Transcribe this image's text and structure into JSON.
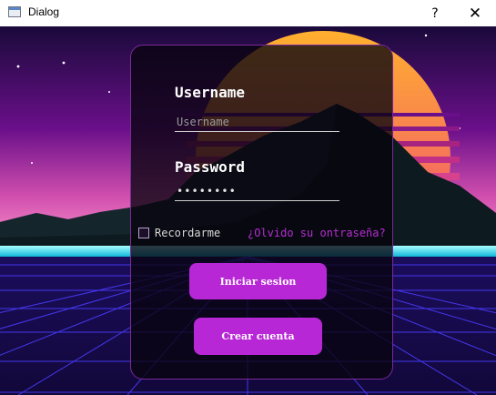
{
  "window": {
    "title": "Dialog",
    "help_label": "?",
    "close_label": "✕"
  },
  "login": {
    "username_label": "Username",
    "username_placeholder": "Username",
    "password_label": "Password",
    "password_value": "••••••••",
    "remember_label": "Recordarme",
    "forgot_label": "¿Olvido su ontraseña?",
    "login_button": "Iniciar sesion",
    "register_button": "Crear cuenta"
  },
  "colors": {
    "accent": "#b827d6",
    "link": "#b52ed0",
    "sun_top": "#ff9a3a",
    "sun_bottom": "#e8407a",
    "grid": "#3b3bff"
  },
  "icons": {
    "app": "window-icon"
  }
}
